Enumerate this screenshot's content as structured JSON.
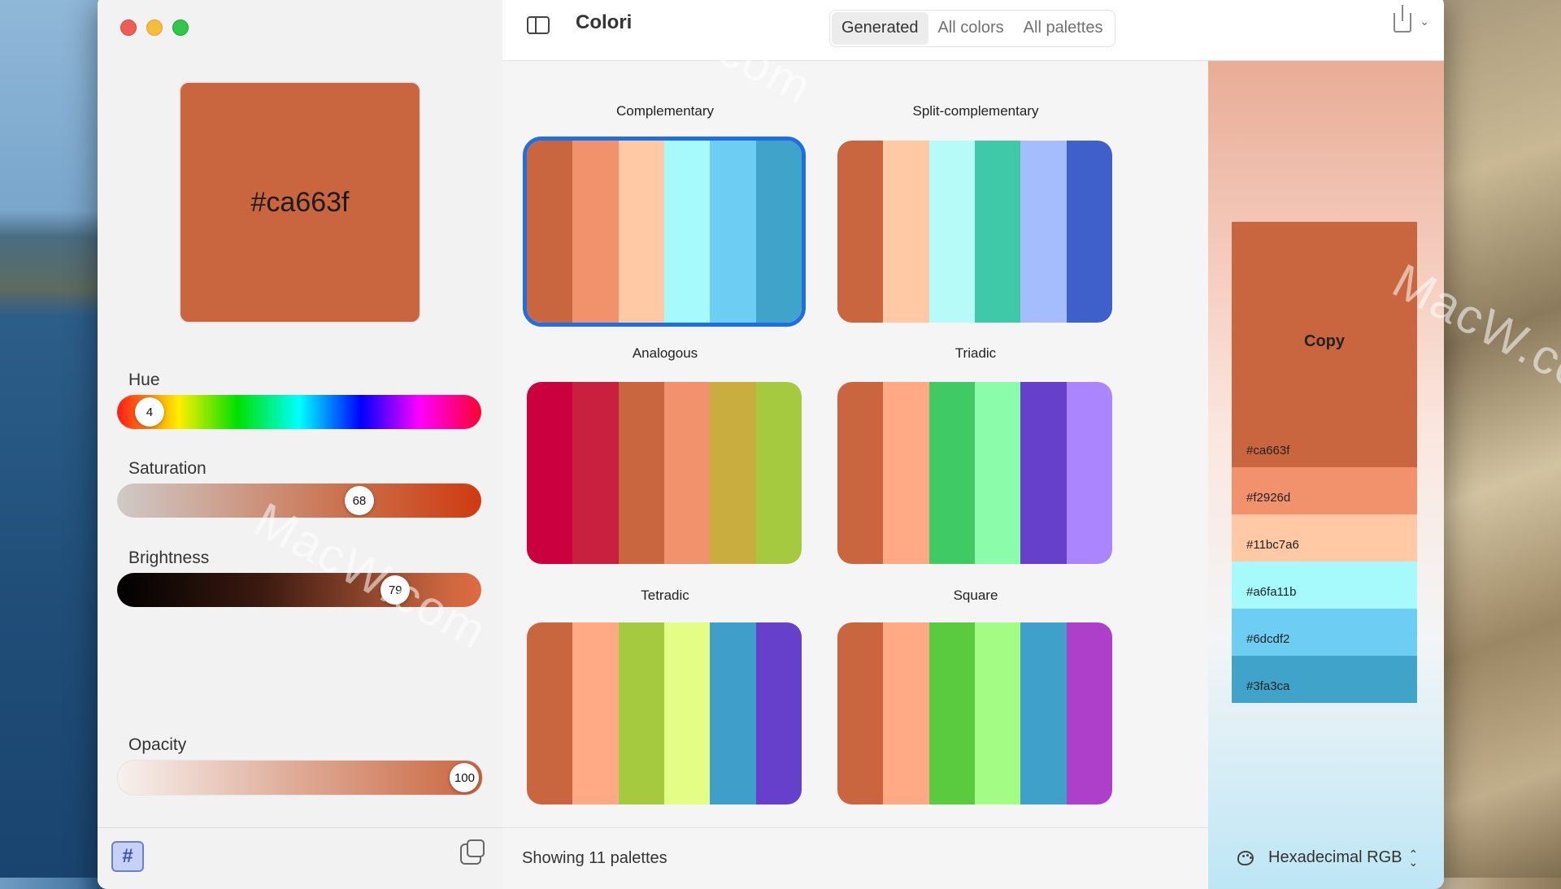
{
  "window": {
    "title": "Colori",
    "tabs": [
      {
        "label": "Generated",
        "active": true
      },
      {
        "label": "All colors",
        "active": false
      },
      {
        "label": "All palettes",
        "active": false
      }
    ]
  },
  "current_color": {
    "hex": "#ca663f",
    "color": "#ca663f"
  },
  "sliders": {
    "hue": {
      "label": "Hue",
      "value": "4",
      "fraction": 0.089
    },
    "saturation": {
      "label": "Saturation",
      "value": "68",
      "fraction": 0.665
    },
    "brightness": {
      "label": "Brightness",
      "value": "79",
      "fraction": 0.764
    },
    "opacity": {
      "label": "Opacity",
      "value": "100",
      "fraction": 0.952
    }
  },
  "palettes": [
    {
      "name": "Complementary",
      "selected": true,
      "colors": [
        "#ca663f",
        "#f2926d",
        "#ffc9a6",
        "#a6fafb",
        "#6dcdf2",
        "#3fa3ca"
      ]
    },
    {
      "name": "Split-complementary",
      "selected": false,
      "colors": [
        "#ca663f",
        "#ffc9a6",
        "#b6fbf7",
        "#3fc9a8",
        "#a6bdfd",
        "#3f5fca"
      ]
    },
    {
      "name": "Analogous",
      "selected": false,
      "colors": [
        "#ca003f",
        "#ca2040",
        "#ca663f",
        "#f2926d",
        "#caad3f",
        "#a6ca3f"
      ]
    },
    {
      "name": "Triadic",
      "selected": false,
      "colors": [
        "#ca663f",
        "#ffaa85",
        "#3fca66",
        "#8bfdaa",
        "#663fca",
        "#aa85fd"
      ]
    },
    {
      "name": "Tetradic",
      "selected": false,
      "colors": [
        "#ca663f",
        "#ffaa85",
        "#a6ca3f",
        "#e3fd85",
        "#3f9fca",
        "#663fca"
      ]
    },
    {
      "name": "Square",
      "selected": false,
      "colors": [
        "#ca663f",
        "#ffaa85",
        "#5aca3f",
        "#a3fd85",
        "#3fa0ca",
        "#ad3fca"
      ]
    }
  ],
  "status": {
    "showing": "Showing 11 palettes"
  },
  "detail": {
    "copy_label": "Copy",
    "colors": [
      {
        "hex": "#ca663f",
        "color": "#ca663f"
      },
      {
        "hex": "#f2926d",
        "color": "#f2926d"
      },
      {
        "hex": "#11bc7a6",
        "color": "#ffc9a6"
      },
      {
        "hex": "#a6fa11b",
        "color": "#a6fafb"
      },
      {
        "hex": "#6dcdf2",
        "color": "#6dcdf2"
      },
      {
        "hex": "#3fa3ca",
        "color": "#3fa3ca"
      }
    ],
    "format": "Hexadecimal RGB"
  },
  "icons": {
    "sidebar_toggle": "sidebar-toggle-icon",
    "share": "share-icon",
    "hash": "hash-icon",
    "random": "dice-icon",
    "palette": "palette-icon"
  },
  "watermark": "MacW.com"
}
